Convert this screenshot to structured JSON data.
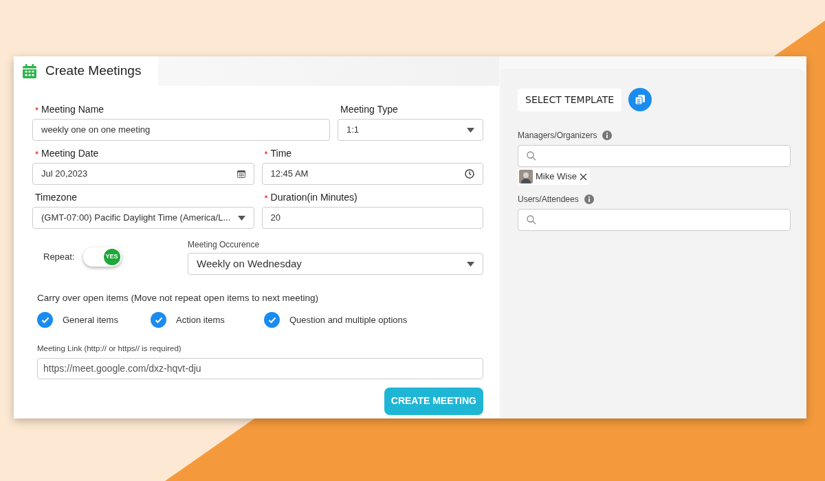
{
  "header": {
    "title": "Create Meetings"
  },
  "form_rows": [
    [
      {
        "kind": "text",
        "marker": "*",
        "label": "Meeting Name",
        "value": "weekly one on one meeting"
      },
      {
        "kind": "select",
        "label": "Meeting Type",
        "value": "1:1"
      }
    ],
    [
      {
        "kind": "date",
        "marker": "*",
        "label": "Meeting Date",
        "value": "Jul 20,2023"
      },
      {
        "kind": "time",
        "marker": "*",
        "label": "Time",
        "value": "12:45 AM"
      }
    ],
    [
      {
        "kind": "select",
        "label": "Timezone",
        "value": "(GMT-07:00) Pacific Daylight Time (America/L..."
      },
      {
        "kind": "text",
        "marker": "*",
        "label": "Duration(in Minutes)",
        "value": "20"
      }
    ]
  ],
  "repeat": {
    "label": "Repeat:",
    "on": true,
    "toggle_text": "YES"
  },
  "occurrence": {
    "label": "Meeting Occurence",
    "value": "Weekly on Wednesday"
  },
  "carry_over": {
    "label": "Carry over open items (Move not repeat open items to next meeting)",
    "options": [
      {
        "label": "General items",
        "checked": true
      },
      {
        "label": "Action items",
        "checked": true
      },
      {
        "label": "Question and multiple options",
        "checked": true
      }
    ]
  },
  "meeting_link": {
    "label": "Meeting Link (http:// or https// is required)",
    "value": "https://meet.google.com/dxz-hqvt-dju"
  },
  "submit": "CREATE MEETING",
  "template": {
    "button": "SELECT TEMPLATE"
  },
  "people": [
    {
      "label": "Managers/Organizers",
      "chips": [
        {
          "name": "Mike Wise"
        }
      ]
    },
    {
      "label": "Users/Attendees"
    }
  ]
}
